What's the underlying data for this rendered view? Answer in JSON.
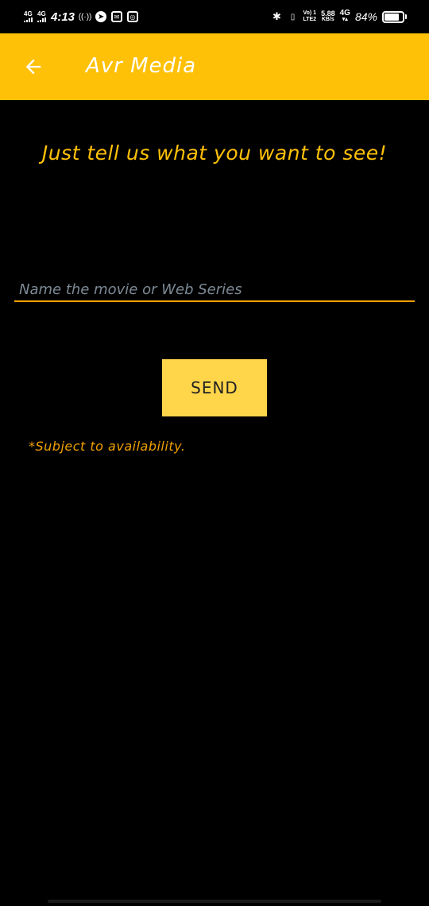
{
  "status_bar": {
    "sim1": "4G",
    "sim2": "4G",
    "time": "4:13",
    "volte": "Vo) 1",
    "lte": "LTE2",
    "speed": "5.88",
    "speed_unit": "KB/s",
    "net": "4G",
    "battery": "84%",
    "battery_level": 0.84
  },
  "app_bar": {
    "title": "Avr Media",
    "color": "#ffc107"
  },
  "main": {
    "headline": "Just tell us what you want to see!",
    "input_placeholder": "Name the movie or Web Series",
    "input_value": "",
    "send_label": "SEND",
    "note": "*Subject to availability."
  },
  "colors": {
    "accent": "#ffc107",
    "button": "#ffd54a",
    "note": "#f0a000",
    "background": "#000000"
  }
}
